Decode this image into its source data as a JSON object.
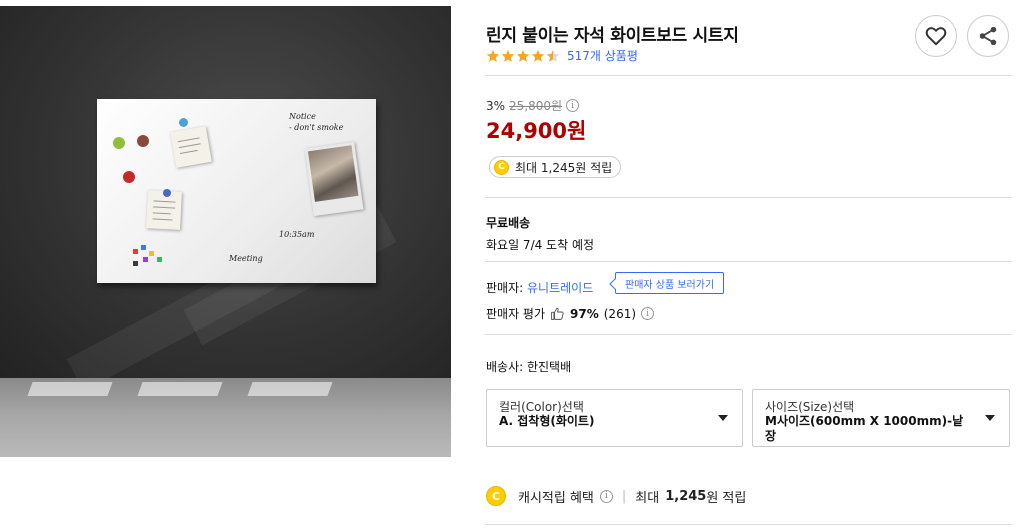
{
  "product": {
    "title": "린지 붙이는 자석 화이트보드 시트지",
    "rating_value": 4.5,
    "review_count": "517개 상품평"
  },
  "image": {
    "alt": "magnetic whiteboard sheet on dark wall",
    "note_text": "Notice\n- don't smoke",
    "time_text": "10:35am",
    "meeting_text": "Meeting"
  },
  "price": {
    "discount_rate": "3%",
    "original_price": "25,800원",
    "sale_price": "24,900원",
    "cash_reward": "최대 1,245원 적립"
  },
  "shipping": {
    "type": "무료배송",
    "arrival": "화요일 7/4 도착 예정"
  },
  "seller": {
    "label": "판매자:",
    "name": "유니트레이드",
    "view_button": "판매자 상품 보러가기",
    "rating_label": "판매자 평가",
    "rating_percent": "97%",
    "rating_count": "(261)"
  },
  "delivery": {
    "carrier": "배송사: 한진택배"
  },
  "options": [
    {
      "label": "컬러(Color)선택",
      "value": "A. 접착형(화이트)"
    },
    {
      "label": "사이즈(Size)선택",
      "value": "M사이즈(600mm X 1000mm)-낱장"
    }
  ],
  "cash_benefit": {
    "label": "캐시적립 혜택",
    "max_prefix": "최대",
    "amount": "1,245",
    "suffix": "원 적립"
  },
  "icons": {
    "wishlist": "heart-icon",
    "share": "share-icon",
    "coin": "cash-coin-icon",
    "info": "info-icon",
    "thumb": "thumbs-up-icon",
    "dropdown": "caret-down-icon"
  },
  "colors": {
    "price_red": "#ae0000",
    "link_blue": "#346aff",
    "star_orange": "#f5a623",
    "coin_yellow": "#ffcc00"
  },
  "coin_letter": "C"
}
